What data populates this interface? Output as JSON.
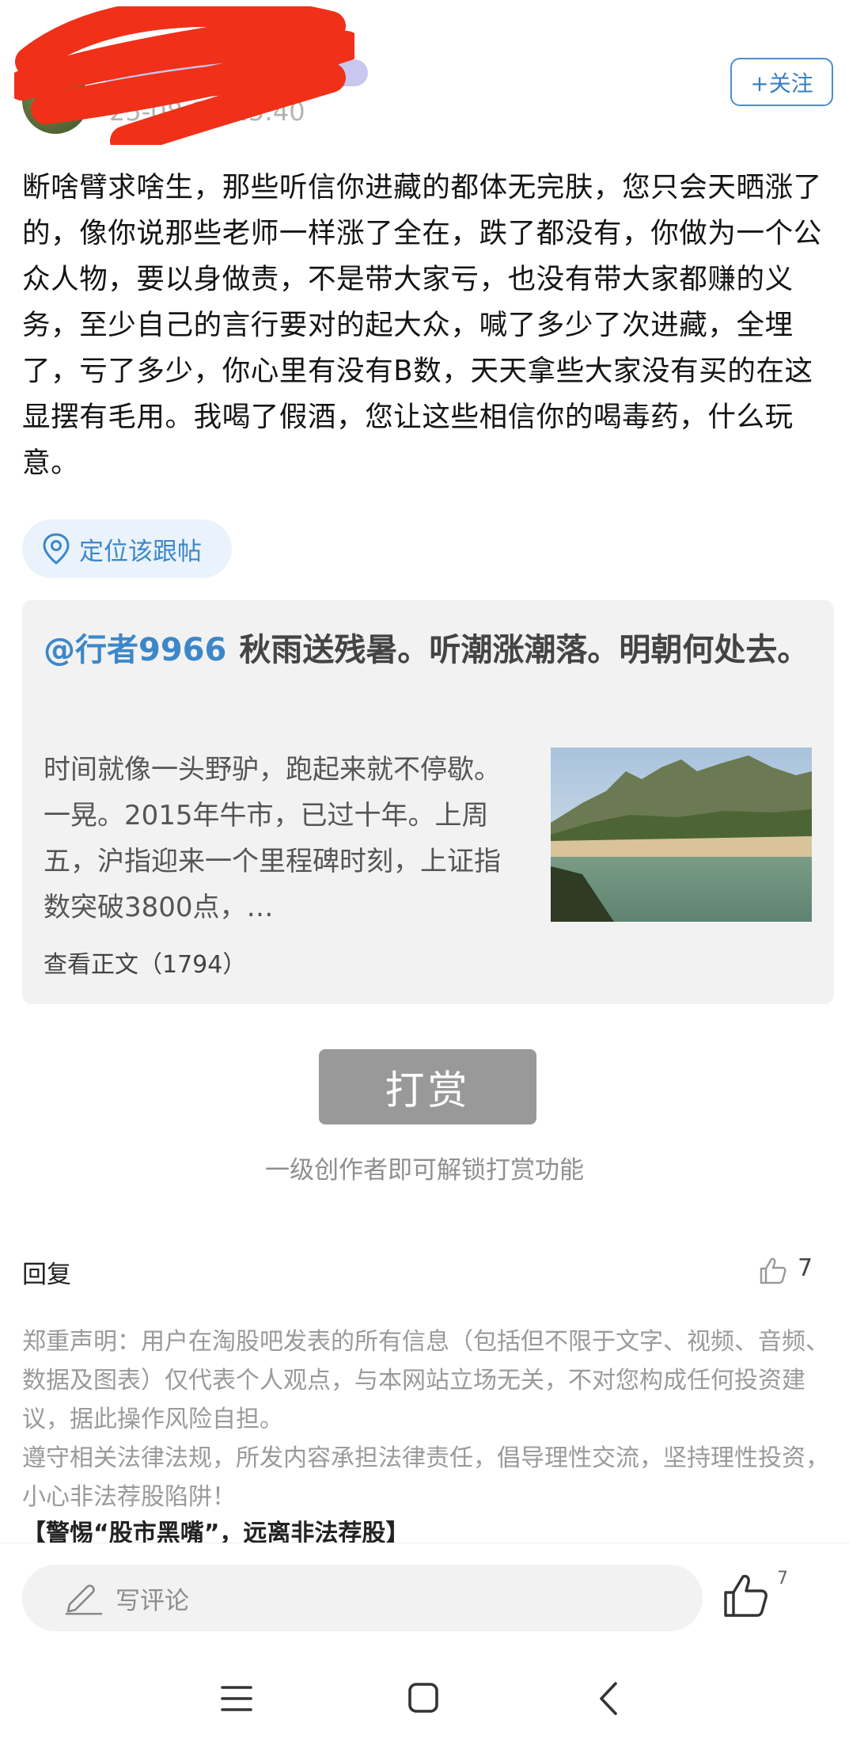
{
  "header": {
    "timestamp": "25-08-27 15:40",
    "follow_label": "+关注"
  },
  "post": {
    "body": "断啥臂求啥生，那些听信你进藏的都体无完肤，您只会天晒涨了的，像你说那些老师一样涨了全在，跌了都没有，你做为一个公众人物，要以身做责，不是带大家亏，也没有带大家都赚的义务，至少自己的言行要对的起大众，喊了多少了次进藏，全埋了，亏了多少，你心里有没有B数，天天拿些大家没有买的在这显摆有毛用。我喝了假酒，您让这些相信你的喝毒药，什么玩意。"
  },
  "locate": {
    "label": "定位该跟帖",
    "icon": "location-pin-icon"
  },
  "quote": {
    "mention": "@行者9966",
    "title": "秋雨送残暑。听潮涨潮落。明朝何处去。",
    "excerpt": "时间就像一头野驴，跑起来就不停歇。一晃。2015年牛市，已过十年。上周五，沪指迎来一个里程碑时刻，上证指数突破3800点，…",
    "view_more": "查看正文（1794）"
  },
  "tip": {
    "button_label": "打赏",
    "note": "一级创作者即可解锁打赏功能"
  },
  "reply": {
    "label": "回复",
    "like_count": "7",
    "like_icon": "thumbs-up-icon"
  },
  "disclaimer": {
    "text": "郑重声明：用户在淘股吧发表的所有信息（包括但不限于文字、视频、音频、数据及图表）仅代表个人观点，与本网站立场无关，不对您构成任何投资建议，据此操作风险自担。",
    "law": "遵守相关法律法规，所发内容承担法律责任，倡导理性交流，坚持理性投资，小心非法荐股陷阱！",
    "warning": "【警惕“股市黑嘴”，远离非法荐股】"
  },
  "bottom_bar": {
    "comment_placeholder": "写评论",
    "like_count": "7"
  },
  "colors": {
    "accent": "#3d87c9",
    "tip_button": "#999999",
    "quote_bg": "#f2f2f2"
  }
}
